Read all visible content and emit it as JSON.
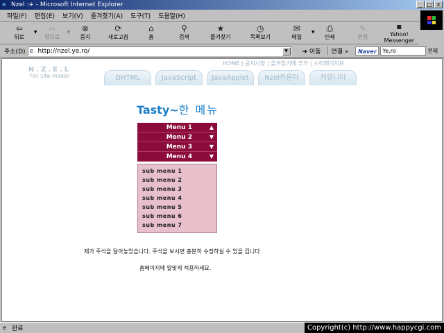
{
  "window": {
    "title": "Nzel :+ - Microsoft Internet Explorer",
    "min": "_",
    "max": "□",
    "close": "×"
  },
  "menubar": [
    "파일(F)",
    "편집(E)",
    "보기(V)",
    "즐겨찾기(A)",
    "도구(T)",
    "도움말(H)"
  ],
  "toolbar": {
    "back": "뒤로",
    "forward": "앞으로",
    "stop": "중지",
    "refresh": "새로고침",
    "home": "홈",
    "search": "검색",
    "favorites": "즐겨찾기",
    "history": "목록보기",
    "mail": "메일",
    "print": "인쇄",
    "edit": "편집",
    "yahoo_l1": "Yahoo!",
    "yahoo_l2": "Messenger",
    "chevron": "»"
  },
  "address": {
    "label": "주소(D)",
    "url": "http://nzel.ye.ro/",
    "go": "이동",
    "links": "연결 »",
    "naver": "Naver",
    "search_value": "Ye,ro",
    "search_all": "전체"
  },
  "page": {
    "logo_line1": "N.Z.E.L",
    "logo_line2": "For site maker",
    "top_links": "HOME | 공지사항 | 즐겨찾기에 추가 | 시작페이지로",
    "tabs": [
      "DHTML",
      "JavaScript",
      "JavaApplet",
      "Nzel카운터",
      "커뮤니티"
    ],
    "heading_en": "Tasty~",
    "heading_kr": "한 메뉴",
    "menus": [
      {
        "label": "Menu 1",
        "arrow": "▲"
      },
      {
        "label": "Menu 2",
        "arrow": "▼"
      },
      {
        "label": "Menu 3",
        "arrow": "▼"
      },
      {
        "label": "Menu 4",
        "arrow": "▼"
      }
    ],
    "submenus": [
      "sub menu 1",
      "sub menu 2",
      "sub menu 3",
      "sub menu 4",
      "sub menu 5",
      "sub menu 6",
      "sub menu 7"
    ],
    "note1": "제가 주석을 달아놓았습니다. 주석을 보시면 충분히 수정하실 수 있을 겁니다",
    "note2": "홈페이지에 알맞게 적용하세요."
  },
  "status": {
    "text": "완료",
    "copyright": "Copyright(c) http://www.happycgi.com"
  },
  "colors": {
    "menu_bg": "#8b0b3a",
    "submenu_bg": "#e8c0cc",
    "heading": "#1b7fc8"
  }
}
